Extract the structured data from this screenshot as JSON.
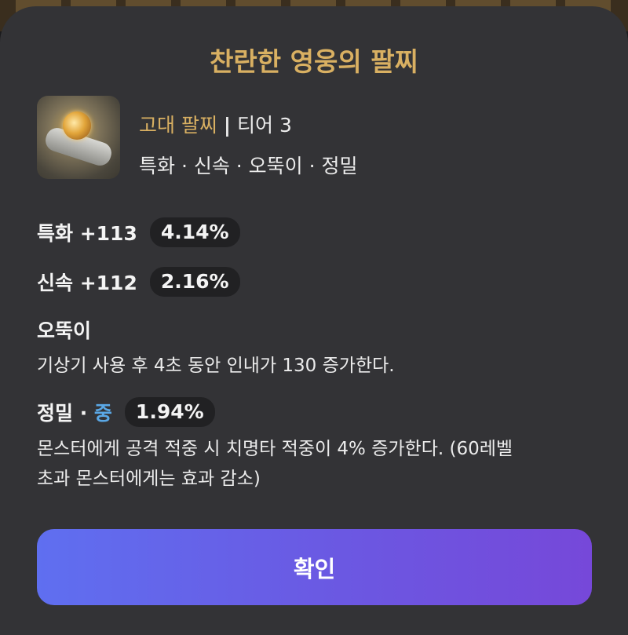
{
  "colors": {
    "sheet_bg": "#333336",
    "title_gold": "#d9b062",
    "accent_blue": "#5aa8e6",
    "pill_bg": "#212123",
    "button_gradient_start": "#5f6ff0",
    "button_gradient_end": "#7648d9"
  },
  "dialog": {
    "title": "찬란한 영웅의 팔찌",
    "item": {
      "icon": "bracelet-icon",
      "category": "고대 팔찌",
      "divider": "|",
      "tier": "티어 3",
      "stats_summary": "특화 · 신속 · 오뚝이 · 정밀"
    },
    "stats": [
      {
        "label": "특화 +113",
        "value": "4.14%"
      },
      {
        "label": "신속 +112",
        "value": "2.16%"
      }
    ],
    "effect1": {
      "name": "오뚝이",
      "description": "기상기 사용 후 4초 동안 인내가 130 증가한다."
    },
    "effect2": {
      "name": "정밀 · ",
      "grade": "중",
      "value": "1.94%",
      "description_line1": "몬스터에게 공격 적중 시 치명타 적중이 4% 증가한다. (60레벨",
      "description_line2": "초과 몬스터에게는 효과 감소)"
    },
    "confirm_label": "확인"
  }
}
